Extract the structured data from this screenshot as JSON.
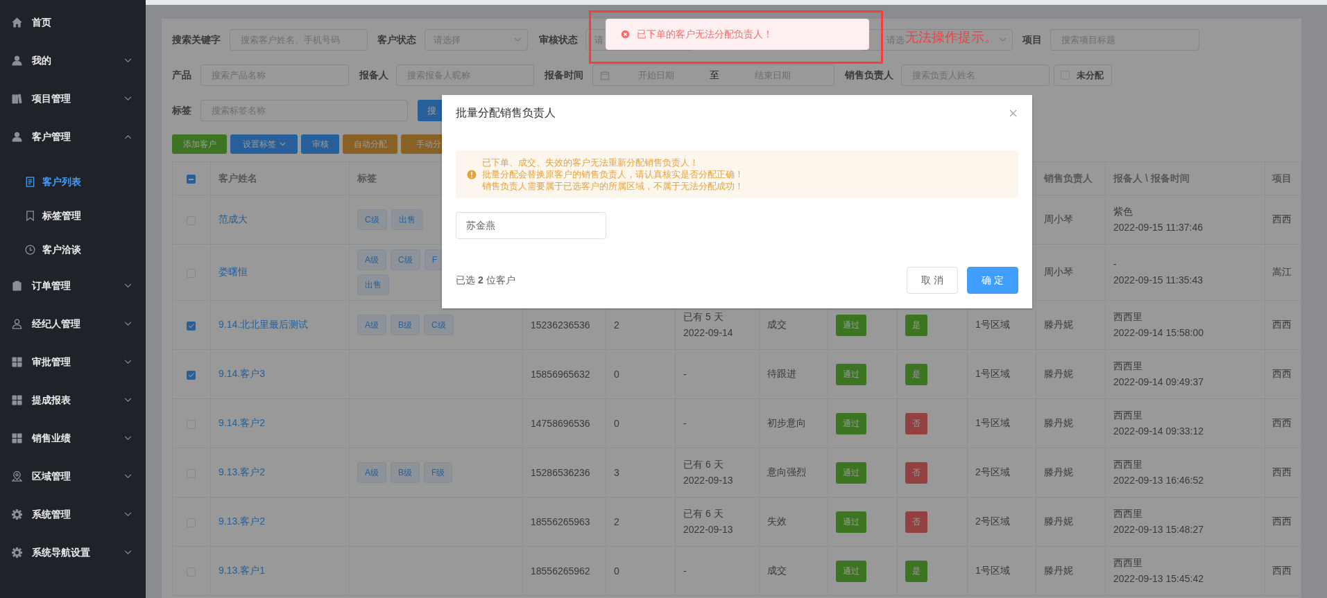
{
  "sidebar": {
    "items": [
      {
        "label": "首页"
      },
      {
        "label": "我的",
        "expanded": false
      },
      {
        "label": "项目管理",
        "expanded": false
      },
      {
        "label": "客户管理",
        "expanded": true,
        "children": [
          {
            "label": "客户列表",
            "selected": true
          },
          {
            "label": "标签管理",
            "selected": false
          },
          {
            "label": "客户洽谈",
            "selected": false
          }
        ]
      },
      {
        "label": "订单管理",
        "expanded": false
      },
      {
        "label": "经纪人管理",
        "expanded": false
      },
      {
        "label": "审批管理",
        "expanded": false
      },
      {
        "label": "提成报表",
        "expanded": false
      },
      {
        "label": "销售业绩",
        "expanded": false
      },
      {
        "label": "区域管理",
        "expanded": false
      },
      {
        "label": "系统管理",
        "expanded": false
      },
      {
        "label": "系统导航设置",
        "expanded": false
      }
    ]
  },
  "filters": {
    "rows": [
      [
        {
          "kind": "label",
          "text": "搜索关键字"
        },
        {
          "kind": "input",
          "placeholder": "搜索客户姓名、手机号码"
        },
        {
          "kind": "label",
          "text": "客户状态"
        },
        {
          "kind": "select",
          "placeholder": "请选择"
        },
        {
          "kind": "label",
          "text": "审核状态"
        },
        {
          "kind": "select",
          "placeholder": "请"
        },
        {
          "kind": "select",
          "placeholder": "请选"
        },
        {
          "kind": "label",
          "text": "项目"
        },
        {
          "kind": "input",
          "placeholder": "搜索项目标题"
        }
      ],
      [
        {
          "kind": "label",
          "text": "产品"
        },
        {
          "kind": "input",
          "placeholder": "搜索产品名称"
        },
        {
          "kind": "label",
          "text": "报备人"
        },
        {
          "kind": "input",
          "placeholder": "搜索报备人昵称"
        },
        {
          "kind": "label",
          "text": "报备时间"
        },
        {
          "kind": "daterange",
          "placeholder_start": "开始日期",
          "separator": "至",
          "placeholder_end": "结束日期"
        },
        {
          "kind": "label",
          "text": "销售负责人"
        },
        {
          "kind": "input",
          "placeholder": "搜索负责人姓名"
        },
        {
          "kind": "checkbox",
          "text": "未分配",
          "checked": false
        }
      ],
      [
        {
          "kind": "label",
          "text": "标签"
        },
        {
          "kind": "input",
          "placeholder": "搜索标签名称"
        },
        {
          "kind": "button",
          "text": "搜"
        }
      ]
    ]
  },
  "actions": [
    {
      "label": "添加客户",
      "kind": "success"
    },
    {
      "label": "设置标签",
      "kind": "primary",
      "dropdown": true
    },
    {
      "label": "审核",
      "kind": "primary"
    },
    {
      "label": "自动分配",
      "kind": "warning"
    },
    {
      "label": "手动分",
      "kind": "warning"
    }
  ],
  "table": {
    "select_all": {
      "indeterminate": true
    },
    "columns": {
      "name": "客户姓名",
      "tags": "标签",
      "sales": "销售负责人",
      "reporter": "报备人 \\ 报备时间",
      "project": "项目"
    },
    "rows": [
      {
        "selected": false,
        "name": "范成大",
        "tags": [
          "C级",
          "出售"
        ],
        "sales": "周小琴",
        "reporter": [
          "紫色",
          "2022-09-15 11:37:46"
        ],
        "project": "西西"
      },
      {
        "selected": false,
        "name": "娄曙恒",
        "tags": [
          "A级",
          "C级",
          "F",
          "出售"
        ],
        "sales": "周小琴",
        "reporter": [
          "-",
          "2022-09-15 11:35:43"
        ],
        "project": "嵩江"
      },
      {
        "selected": true,
        "name": "9.14.北北里最后测试",
        "tags": [
          "A级",
          "B级",
          "C级"
        ],
        "phone": "15236236536",
        "count": "2",
        "follow": [
          "已有 5 天",
          "2022-09-14"
        ],
        "status": "成交",
        "audit": "通过",
        "assigned": {
          "label": "是",
          "kind": "yes"
        },
        "region": "1号区域",
        "sales": "滕丹妮",
        "reporter": [
          "西西里",
          "2022-09-14 15:58:00"
        ],
        "project": "西西"
      },
      {
        "selected": true,
        "name": "9.14.客户3",
        "tags": [],
        "phone": "15856965632",
        "count": "0",
        "follow": [
          "-"
        ],
        "status": "待跟进",
        "audit": "通过",
        "assigned": {
          "label": "是",
          "kind": "yes"
        },
        "region": "1号区域",
        "sales": "滕丹妮",
        "reporter": [
          "西西里",
          "2022-09-14 09:49:37"
        ],
        "project": "西西"
      },
      {
        "selected": false,
        "name": "9.14.客户2",
        "tags": [],
        "phone": "14758696536",
        "count": "0",
        "follow": [
          "-"
        ],
        "status": "初步意向",
        "audit": "通过",
        "assigned": {
          "label": "否",
          "kind": "no"
        },
        "region": "1号区域",
        "sales": "滕丹妮",
        "reporter": [
          "西西里",
          "2022-09-14 09:33:12"
        ],
        "project": "西西"
      },
      {
        "selected": false,
        "name": "9.13.客户2",
        "tags": [
          "A级",
          "B级",
          "F级"
        ],
        "phone": "15286536236",
        "count": "3",
        "follow": [
          "已有 6 天",
          "2022-09-13"
        ],
        "status": "意向强烈",
        "audit": "通过",
        "assigned": {
          "label": "否",
          "kind": "no"
        },
        "region": "2号区域",
        "sales": "滕丹妮",
        "reporter": [
          "西西里",
          "2022-09-13 16:46:52"
        ],
        "project": "西西"
      },
      {
        "selected": false,
        "name": "9.13.客户2",
        "tags": [],
        "phone": "18556265963",
        "count": "2",
        "follow": [
          "已有 6 天",
          "2022-09-13"
        ],
        "status": "失效",
        "audit": "通过",
        "assigned": {
          "label": "否",
          "kind": "no"
        },
        "region": "2号区域",
        "sales": "滕丹妮",
        "reporter": [
          "西西里",
          "2022-09-13 15:48:27"
        ],
        "project": "西西"
      },
      {
        "selected": false,
        "name": "9.13.客户1",
        "tags": [],
        "phone": "18556265962",
        "count": "0",
        "follow": [
          "-"
        ],
        "status": "成交",
        "audit": "通过",
        "assigned": {
          "label": "是",
          "kind": "yes"
        },
        "region": "1号区域",
        "sales": "滕丹妮",
        "reporter": [
          "西西里",
          "2022-09-13 15:45:42"
        ],
        "project": "西西"
      }
    ]
  },
  "toast": {
    "text": "已下单的客户无法分配负责人！"
  },
  "annotation": {
    "text": "无法操作提示。"
  },
  "dialog": {
    "title": "批量分配销售负责人",
    "alert": [
      "已下单、成交、失效的客户无法重新分配销售负责人！",
      "批量分配会替换原客户的销售负责人，请认真核实是否分配正确！",
      "销售负责人需要属于已选客户的所属区域，不属于无法分配成功！"
    ],
    "value": "苏金燕",
    "selection": "已选 **2** 位客户",
    "buttons": [
      {
        "label": "取 消",
        "kind": "default"
      },
      {
        "label": "确 定",
        "kind": "primary"
      }
    ]
  }
}
